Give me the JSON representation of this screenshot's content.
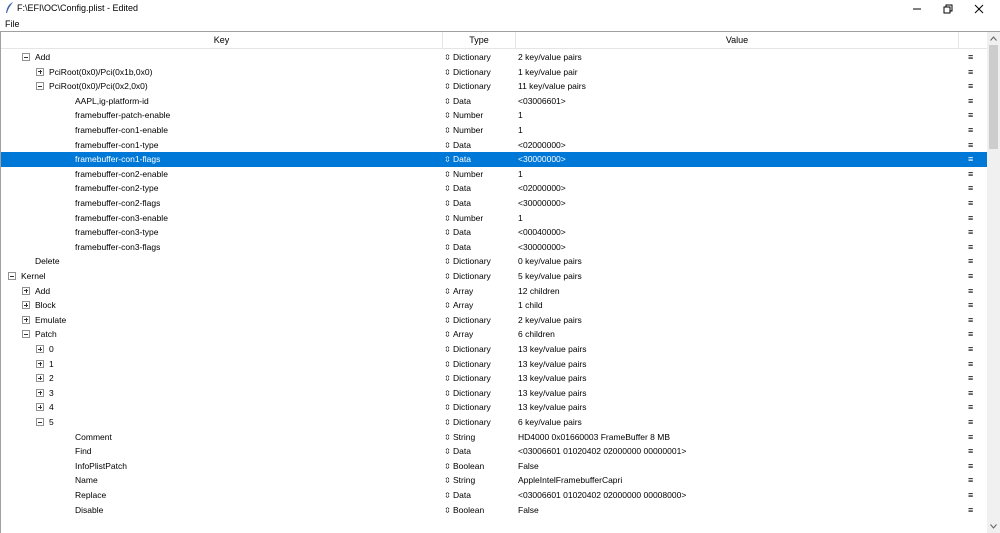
{
  "window": {
    "title": "F:\\EFI\\OC\\Config.plist - Edited",
    "app_icon": "feather-pen-icon",
    "controls": [
      "minimize-icon",
      "maximize-icon",
      "close-icon"
    ]
  },
  "menubar": {
    "file": "File"
  },
  "columns": {
    "key": "Key",
    "type": "Type",
    "value": "Value"
  },
  "selection_color": "#0078d7",
  "rows": [
    {
      "level": 2,
      "expander": "collapse",
      "key": "Add",
      "type": "Dictionary",
      "value": "2 key/value pairs"
    },
    {
      "level": 3,
      "expander": "expand",
      "key": "PciRoot(0x0)/Pci(0x1b,0x0)",
      "type": "Dictionary",
      "value": "1 key/value pair"
    },
    {
      "level": 3,
      "expander": "collapse",
      "key": "PciRoot(0x0)/Pci(0x2,0x0)",
      "type": "Dictionary",
      "value": "11 key/value pairs"
    },
    {
      "level": 4,
      "expander": "none",
      "key": "AAPL,ig-platform-id",
      "type": "Data",
      "value": "<03006601>"
    },
    {
      "level": 4,
      "expander": "none",
      "key": "framebuffer-patch-enable",
      "type": "Number",
      "value": "1"
    },
    {
      "level": 4,
      "expander": "none",
      "key": "framebuffer-con1-enable",
      "type": "Number",
      "value": "1"
    },
    {
      "level": 4,
      "expander": "none",
      "key": "framebuffer-con1-type",
      "type": "Data",
      "value": "<02000000>"
    },
    {
      "level": 4,
      "expander": "none",
      "key": "framebuffer-con1-flags",
      "type": "Data",
      "value": "<30000000>",
      "selected": true
    },
    {
      "level": 4,
      "expander": "none",
      "key": "framebuffer-con2-enable",
      "type": "Number",
      "value": "1"
    },
    {
      "level": 4,
      "expander": "none",
      "key": "framebuffer-con2-type",
      "type": "Data",
      "value": "<02000000>"
    },
    {
      "level": 4,
      "expander": "none",
      "key": "framebuffer-con2-flags",
      "type": "Data",
      "value": "<30000000>"
    },
    {
      "level": 4,
      "expander": "none",
      "key": "framebuffer-con3-enable",
      "type": "Number",
      "value": "1"
    },
    {
      "level": 4,
      "expander": "none",
      "key": "framebuffer-con3-type",
      "type": "Data",
      "value": "<00040000>"
    },
    {
      "level": 4,
      "expander": "none",
      "key": "framebuffer-con3-flags",
      "type": "Data",
      "value": "<30000000>"
    },
    {
      "level": 2,
      "expander": "none",
      "key": "Delete",
      "type": "Dictionary",
      "value": "0 key/value pairs"
    },
    {
      "level": 1,
      "expander": "collapse",
      "key": "Kernel",
      "type": "Dictionary",
      "value": "5 key/value pairs"
    },
    {
      "level": 2,
      "expander": "expand",
      "key": "Add",
      "type": "Array",
      "value": "12 children"
    },
    {
      "level": 2,
      "expander": "expand",
      "key": "Block",
      "type": "Array",
      "value": "1 child"
    },
    {
      "level": 2,
      "expander": "expand",
      "key": "Emulate",
      "type": "Dictionary",
      "value": "2 key/value pairs"
    },
    {
      "level": 2,
      "expander": "collapse",
      "key": "Patch",
      "type": "Array",
      "value": "6 children"
    },
    {
      "level": 3,
      "expander": "expand",
      "key": "0",
      "type": "Dictionary",
      "value": "13 key/value pairs"
    },
    {
      "level": 3,
      "expander": "expand",
      "key": "1",
      "type": "Dictionary",
      "value": "13 key/value pairs"
    },
    {
      "level": 3,
      "expander": "expand",
      "key": "2",
      "type": "Dictionary",
      "value": "13 key/value pairs"
    },
    {
      "level": 3,
      "expander": "expand",
      "key": "3",
      "type": "Dictionary",
      "value": "13 key/value pairs"
    },
    {
      "level": 3,
      "expander": "expand",
      "key": "4",
      "type": "Dictionary",
      "value": "13 key/value pairs"
    },
    {
      "level": 3,
      "expander": "collapse",
      "key": "5",
      "type": "Dictionary",
      "value": "6 key/value pairs"
    },
    {
      "level": 4,
      "expander": "none",
      "key": "Comment",
      "type": "String",
      "value": "HD4000 0x01660003 FrameBuffer 8 MB"
    },
    {
      "level": 4,
      "expander": "none",
      "key": "Find",
      "type": "Data",
      "value": "<03006601 01020402 02000000 00000001>"
    },
    {
      "level": 4,
      "expander": "none",
      "key": "InfoPlistPatch",
      "type": "Boolean",
      "value": "False"
    },
    {
      "level": 4,
      "expander": "none",
      "key": "Name",
      "type": "String",
      "value": "AppleIntelFramebufferCapri"
    },
    {
      "level": 4,
      "expander": "none",
      "key": "Replace",
      "type": "Data",
      "value": "<03006601 01020402 02000000 00008000>"
    },
    {
      "level": 4,
      "expander": "none",
      "key": "Disable",
      "type": "Boolean",
      "value": "False"
    }
  ],
  "row_type_arrow": "⇳",
  "row_menu_glyph": "≡"
}
